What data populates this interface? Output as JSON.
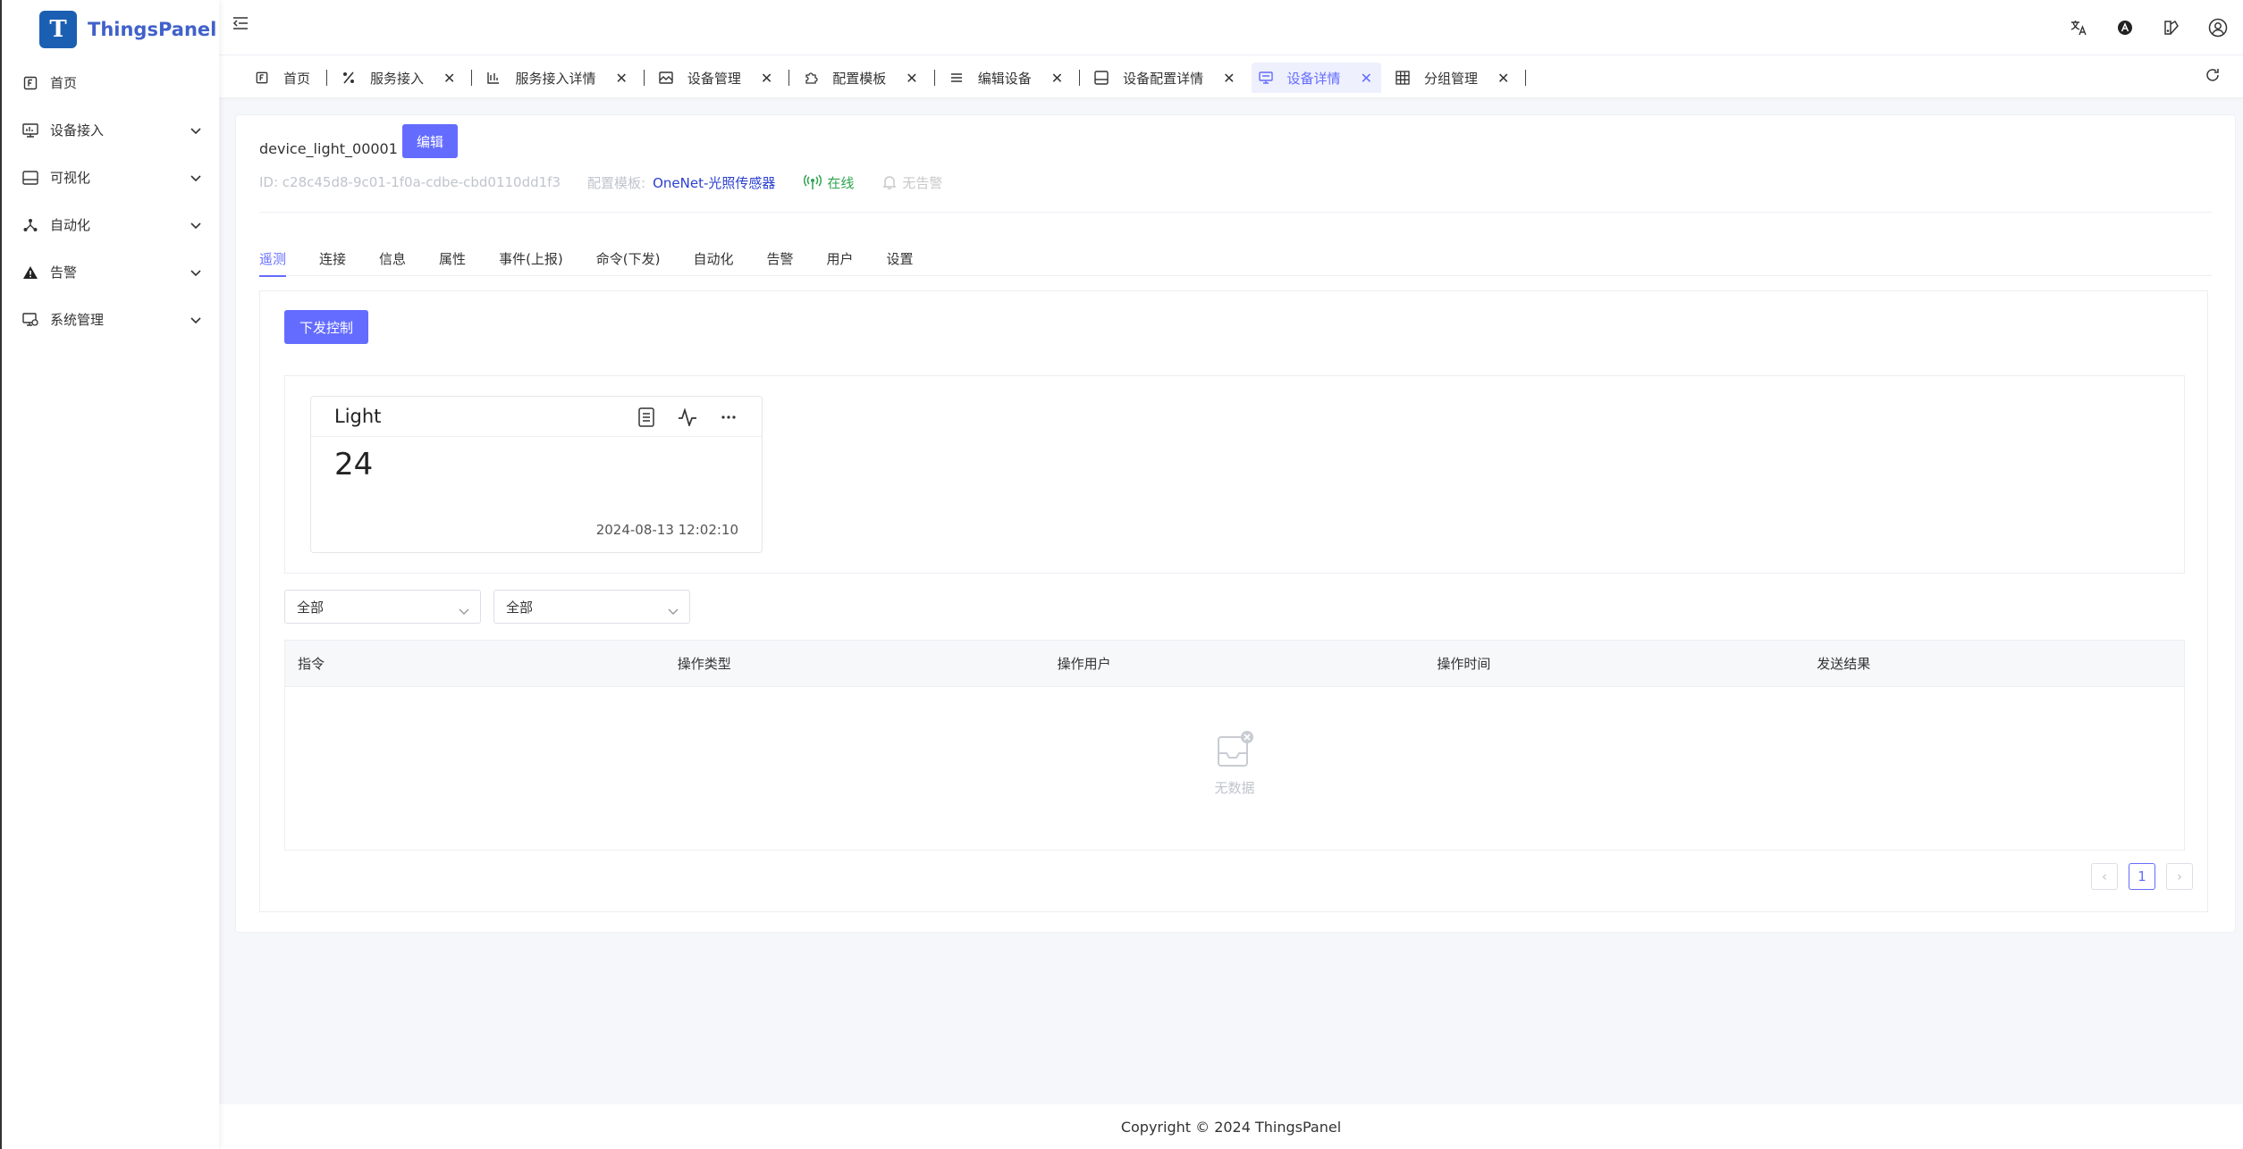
{
  "app": {
    "name": "ThingsPanel"
  },
  "sidebar": {
    "items": [
      {
        "label": "首页",
        "icon": "home-icon"
      },
      {
        "label": "设备接入",
        "icon": "device-access-icon"
      },
      {
        "label": "可视化",
        "icon": "visualization-icon"
      },
      {
        "label": "自动化",
        "icon": "automation-icon"
      },
      {
        "label": "告警",
        "icon": "alarm-icon"
      },
      {
        "label": "系统管理",
        "icon": "system-management-icon"
      }
    ]
  },
  "tabs": [
    {
      "label": "首页",
      "icon": "home-icon",
      "closable": false
    },
    {
      "label": "服务接入",
      "icon": "percent-icon",
      "closable": true
    },
    {
      "label": "服务接入详情",
      "icon": "service-detail-icon",
      "closable": true
    },
    {
      "label": "设备管理",
      "icon": "image-icon",
      "closable": true
    },
    {
      "label": "配置模板",
      "icon": "puzzle-icon",
      "closable": true
    },
    {
      "label": "编辑设备",
      "icon": "list-icon",
      "closable": true
    },
    {
      "label": "设备配置详情",
      "icon": "panel-icon",
      "closable": true
    },
    {
      "label": "设备详情",
      "icon": "monitor-icon",
      "closable": true,
      "active": true
    },
    {
      "label": "分组管理",
      "icon": "grid-icon",
      "closable": true
    }
  ],
  "device": {
    "name": "device_light_00001",
    "edit_label": "编辑",
    "id_text": "ID:  c28c45d8-9c01-1f0a-cdbe-cbd0110dd1f3",
    "template_label": "配置模板:",
    "template_value": "OneNet-光照传感器",
    "status_online": "在线",
    "status_alarm": "无告警"
  },
  "subtabs": [
    "遥测",
    "连接",
    "信息",
    "属性",
    "事件(上报)",
    "命令(下发)",
    "自动化",
    "告警",
    "用户",
    "设置"
  ],
  "telemetry": {
    "send_control_label": "下发控制",
    "card": {
      "title": "Light",
      "value": "24",
      "time": "2024-08-13 12:02:10"
    }
  },
  "filters": {
    "filter1": "全部",
    "filter2": "全部"
  },
  "table": {
    "columns": [
      "指令",
      "操作类型",
      "操作用户",
      "操作时间",
      "发送结果"
    ],
    "empty_text": "无数据"
  },
  "pagination": {
    "prev": "‹",
    "current": "1",
    "next": "›"
  },
  "footer": {
    "copyright": "Copyright © 2024 ThingsPanel"
  },
  "colors": {
    "primary": "#646cff",
    "logo": "#1b5fb2",
    "online": "#2ea44f",
    "link": "#2a3fd0"
  }
}
